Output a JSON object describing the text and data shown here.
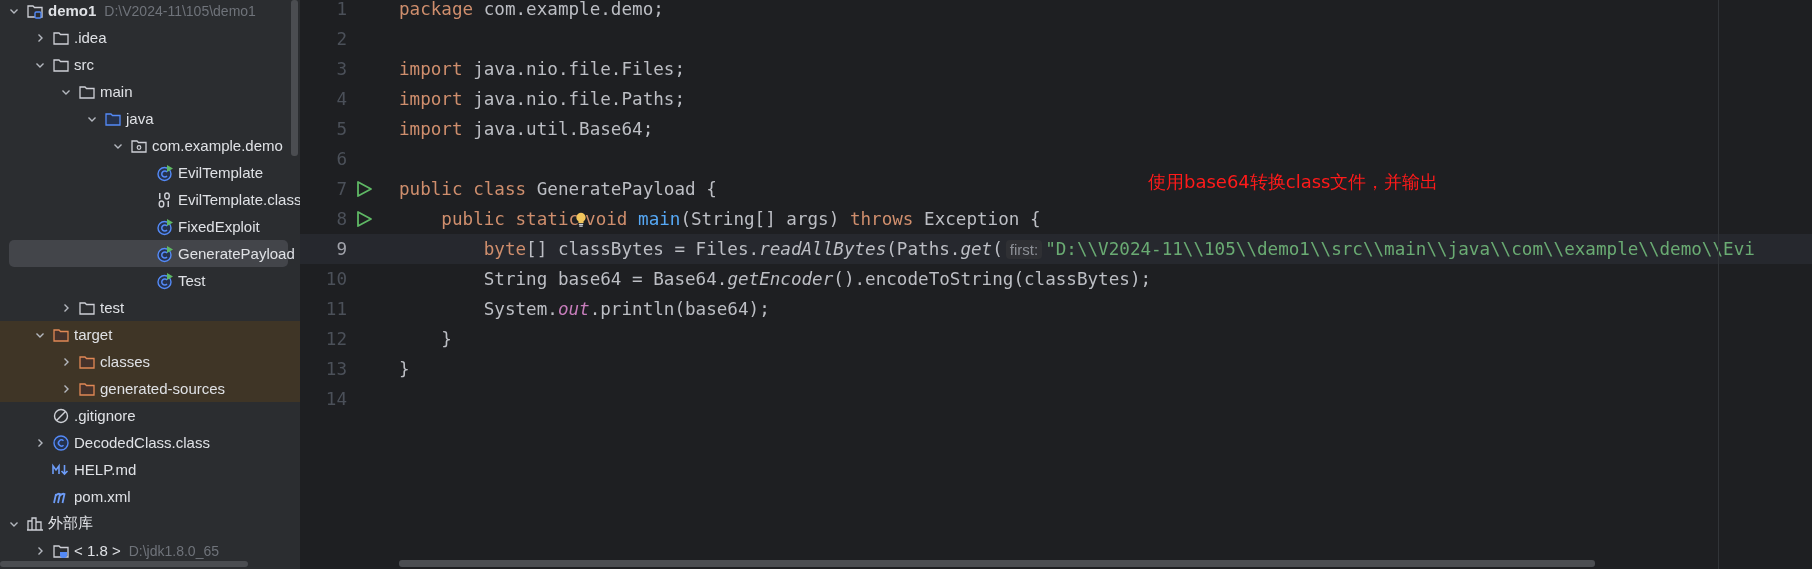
{
  "project_tree": [
    {
      "label": "demo1",
      "kind": "module",
      "path": "D:\\V2024-11\\105\\demo1",
      "expanded": true,
      "selected": false,
      "excluded": false,
      "children": [
        {
          "label": ".idea",
          "kind": "folder",
          "expanded": false,
          "selected": false,
          "excluded": false
        },
        {
          "label": "src",
          "kind": "folder",
          "expanded": true,
          "selected": false,
          "excluded": false,
          "children": [
            {
              "label": "main",
              "kind": "folder",
              "expanded": true,
              "selected": false,
              "excluded": false,
              "children": [
                {
                  "label": "java",
                  "kind": "source-folder",
                  "expanded": true,
                  "selected": false,
                  "excluded": false,
                  "children": [
                    {
                      "label": "com.example.demo",
                      "kind": "package",
                      "expanded": true,
                      "selected": false,
                      "excluded": false,
                      "children": [
                        {
                          "label": "EvilTemplate",
                          "kind": "runnable-class",
                          "selected": false,
                          "excluded": false
                        },
                        {
                          "label": "EvilTemplate.class",
                          "kind": "binary",
                          "selected": false,
                          "excluded": false
                        },
                        {
                          "label": "FixedExploit",
                          "kind": "runnable-class",
                          "selected": false,
                          "excluded": false
                        },
                        {
                          "label": "GeneratePayload",
                          "kind": "runnable-class",
                          "selected": true,
                          "excluded": false
                        },
                        {
                          "label": "Test",
                          "kind": "runnable-class",
                          "selected": false,
                          "excluded": false
                        }
                      ]
                    }
                  ]
                }
              ]
            },
            {
              "label": "test",
              "kind": "folder",
              "expanded": false,
              "selected": false,
              "excluded": false
            }
          ]
        },
        {
          "label": "target",
          "kind": "excluded-folder",
          "expanded": true,
          "selected": false,
          "excluded": true,
          "children": [
            {
              "label": "classes",
              "kind": "excluded-folder",
              "expanded": false,
              "selected": false,
              "excluded": true
            },
            {
              "label": "generated-sources",
              "kind": "excluded-folder",
              "expanded": false,
              "selected": false,
              "excluded": true
            }
          ]
        },
        {
          "label": ".gitignore",
          "kind": "ignore",
          "selected": false,
          "excluded": false
        },
        {
          "label": "DecodedClass.class",
          "kind": "class",
          "expanded": false,
          "selected": false,
          "excluded": false
        },
        {
          "label": "HELP.md",
          "kind": "markdown",
          "selected": false,
          "excluded": false
        },
        {
          "label": "pom.xml",
          "kind": "maven",
          "selected": false,
          "excluded": false
        }
      ]
    },
    {
      "label": "外部库",
      "kind": "library",
      "expanded": true,
      "selected": false,
      "excluded": false,
      "children": [
        {
          "label": "< 1.8 >",
          "kind": "jdk",
          "path": "D:\\jdk1.8.0_65",
          "expanded": false,
          "selected": false,
          "excluded": false
        }
      ]
    }
  ],
  "editor": {
    "lines": [
      {
        "number": "1",
        "run": false,
        "current": false,
        "tokens": [
          {
            "text": "package ",
            "kind": "kw"
          },
          {
            "text": "com.example.demo;",
            "kind": "plain"
          }
        ]
      },
      {
        "number": "2",
        "run": false,
        "current": false
      },
      {
        "number": "3",
        "run": false,
        "current": false,
        "tokens": [
          {
            "text": "import ",
            "kind": "kw"
          },
          {
            "text": "java.nio.file.Files;",
            "kind": "plain"
          }
        ]
      },
      {
        "number": "4",
        "run": false,
        "current": false,
        "tokens": [
          {
            "text": "import ",
            "kind": "kw"
          },
          {
            "text": "java.nio.file.Paths;",
            "kind": "plain"
          }
        ]
      },
      {
        "number": "5",
        "run": false,
        "current": false,
        "tokens": [
          {
            "text": "import ",
            "kind": "kw"
          },
          {
            "text": "java.util.Base64;",
            "kind": "plain"
          }
        ]
      },
      {
        "number": "6",
        "run": false,
        "current": false
      },
      {
        "number": "7",
        "run": true,
        "current": false,
        "tokens": [
          {
            "text": "public class ",
            "kind": "kw"
          },
          {
            "text": "GeneratePayload {",
            "kind": "plain"
          }
        ]
      },
      {
        "number": "8",
        "run": true,
        "current": false,
        "tokens": [
          {
            "text": "    public static",
            "kind": "kw",
            "bulb": true
          },
          {
            "text": "void ",
            "kind": "kw"
          },
          {
            "text": "main",
            "kind": "decl"
          },
          {
            "text": "(String[] args) ",
            "kind": "plain"
          },
          {
            "text": "throws ",
            "kind": "kw"
          },
          {
            "text": "Exception {",
            "kind": "plain"
          }
        ]
      },
      {
        "number": "9",
        "run": false,
        "current": true,
        "tokens": [
          {
            "text": "        byte",
            "kind": "kw"
          },
          {
            "text": "[] classBytes = Files.",
            "kind": "plain"
          },
          {
            "text": "readAllBytes",
            "kind": "static"
          },
          {
            "text": "(Paths.",
            "kind": "plain"
          },
          {
            "text": "get",
            "kind": "static"
          },
          {
            "text": "(",
            "kind": "plain"
          },
          {
            "text": "first:",
            "kind": "hint"
          },
          {
            "text": "\"D:\\\\V2024-11\\\\105\\\\demo1\\\\src\\\\main\\\\java\\\\com\\\\example\\\\demo\\\\Evi",
            "kind": "string"
          }
        ]
      },
      {
        "number": "10",
        "run": false,
        "current": false,
        "tokens": [
          {
            "text": "        String base64 = Base64.",
            "kind": "plain"
          },
          {
            "text": "getEncoder",
            "kind": "static"
          },
          {
            "text": "().encodeToString(classBytes);",
            "kind": "plain"
          }
        ]
      },
      {
        "number": "11",
        "run": false,
        "current": false,
        "tokens": [
          {
            "text": "        System.",
            "kind": "plain"
          },
          {
            "text": "out",
            "kind": "field"
          },
          {
            "text": ".println(base64);",
            "kind": "plain"
          }
        ]
      },
      {
        "number": "12",
        "run": false,
        "current": false,
        "tokens": [
          {
            "text": "    }",
            "kind": "plain"
          }
        ]
      },
      {
        "number": "13",
        "run": false,
        "current": false,
        "tokens": [
          {
            "text": "}",
            "kind": "plain"
          }
        ]
      },
      {
        "number": "14",
        "run": false,
        "current": false
      }
    ],
    "annotation": "使用base64转换class文件，并输出"
  }
}
